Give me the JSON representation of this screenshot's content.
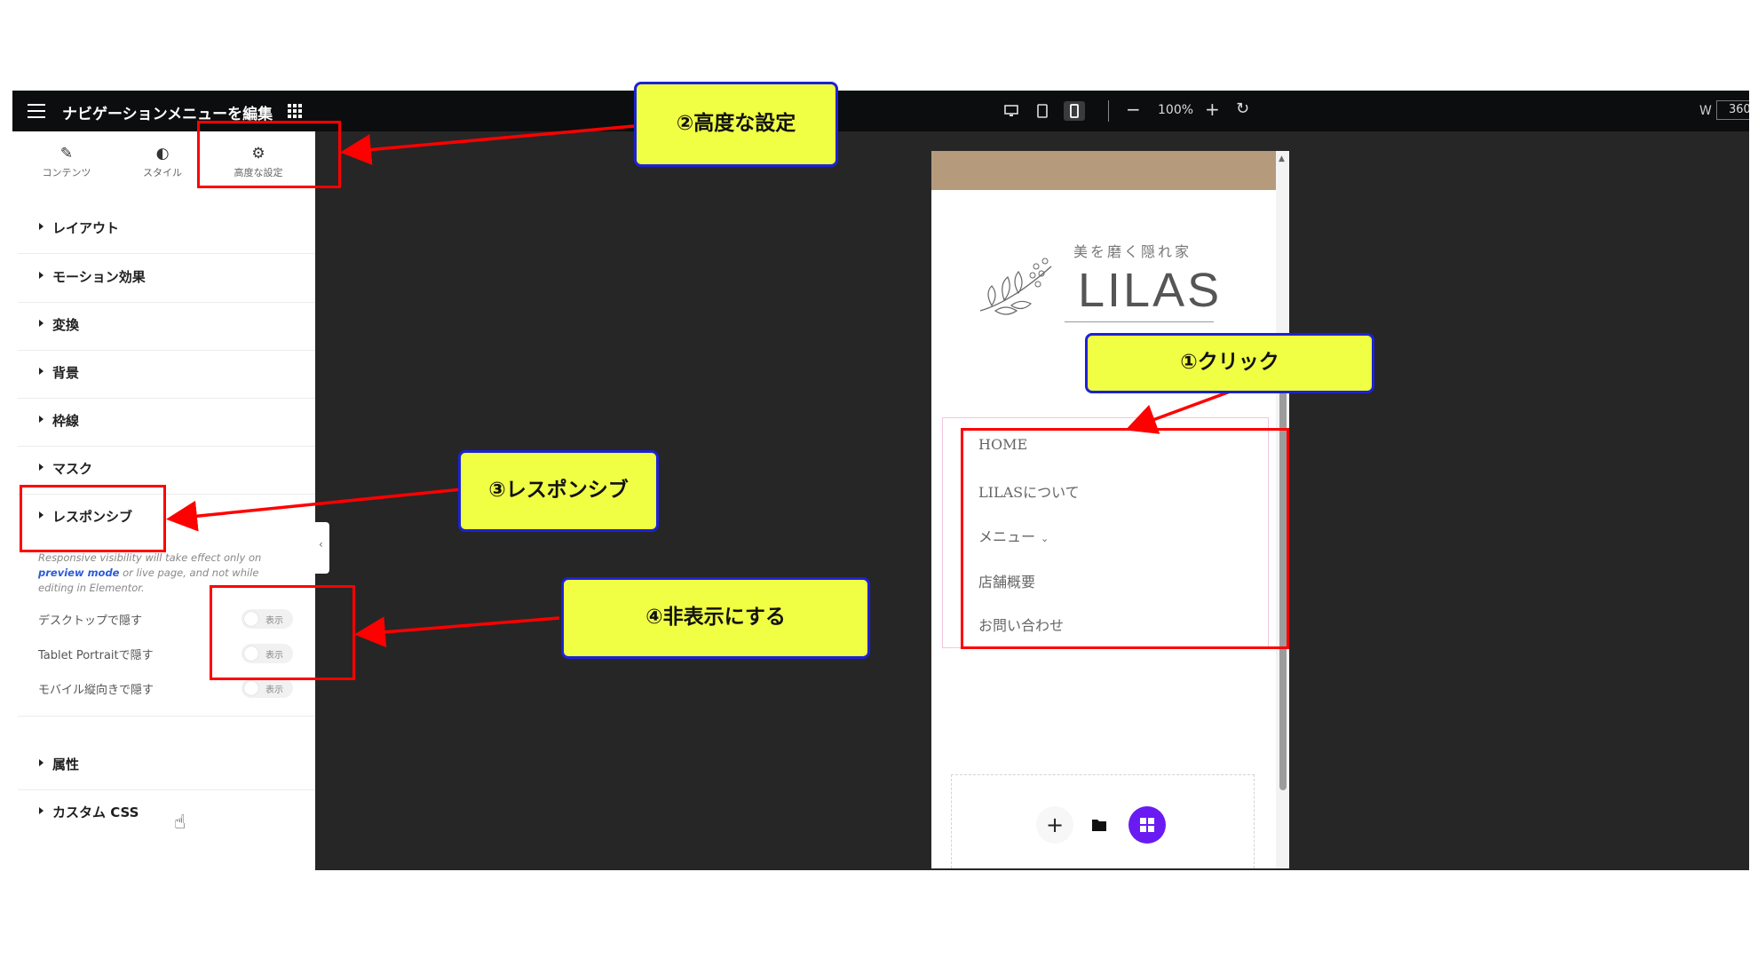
{
  "topbar": {
    "title": "ナビゲーションメニューを編集",
    "zoom": "100%",
    "width_label": "W",
    "width_value": "360",
    "device_selected": "mobile"
  },
  "panel": {
    "tabs": [
      {
        "label": "コンテンツ",
        "icon": "pencil-icon"
      },
      {
        "label": "スタイル",
        "icon": "contrast-icon"
      },
      {
        "label": "高度な設定",
        "icon": "gear-icon"
      }
    ],
    "sections": [
      "レイアウト",
      "モーション効果",
      "変換",
      "背景",
      "枠線",
      "マスク",
      "レスポンシブ"
    ],
    "responsive_note": {
      "before": "Responsive visibility will take effect only on ",
      "link": "preview mode",
      "after": " or live page, and not while editing in Elementor."
    },
    "hide_options": [
      {
        "label": "デスクトップで隠す",
        "toggle": "表示"
      },
      {
        "label": "Tablet Portraitで隠す",
        "toggle": "表示"
      },
      {
        "label": "モバイル縦向きで隠す",
        "toggle": "表示"
      }
    ],
    "bottom_sections": [
      "属性",
      "カスタム CSS"
    ]
  },
  "preview": {
    "logo_tagline": "美を磨く隠れ家",
    "logo_name": "LILAS",
    "menu_items": [
      "HOME",
      "LILASについて",
      "メニュー",
      "店舗概要",
      "お問い合わせ"
    ],
    "header_color": "#b59a7b"
  },
  "callouts": {
    "c1": "①クリック",
    "c2": "②高度な設定",
    "c3": "③レスポンシブ",
    "c4": "④非表示にする"
  },
  "colors": {
    "annotation_red": "#ff0000",
    "callout_fill": "#f0ff43",
    "callout_border": "#1c22d6",
    "accent_purple": "#6a1bf2"
  }
}
